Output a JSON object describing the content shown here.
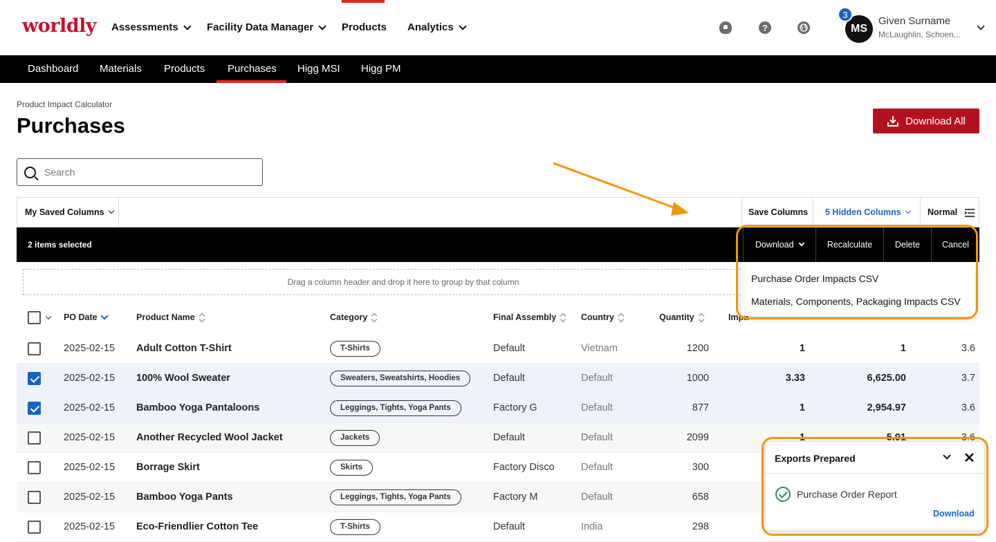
{
  "brand": {
    "logo": "worldly"
  },
  "topnav": {
    "items": [
      {
        "label": "Assessments",
        "dropdown": true
      },
      {
        "label": "Facility Data Manager",
        "dropdown": true
      },
      {
        "label": "Products",
        "dropdown": false,
        "active": true
      },
      {
        "label": "Analytics",
        "dropdown": true
      }
    ],
    "icons": [
      "notifications-icon",
      "help-icon",
      "globe-icon"
    ],
    "user": {
      "initials": "MS",
      "badge": "3",
      "name": "Given Surname",
      "org": "McLaughlin, Schoen..."
    }
  },
  "subnav": {
    "items": [
      "Dashboard",
      "Materials",
      "Products",
      "Purchases",
      "Higg MSI",
      "Higg PM"
    ],
    "active": "Purchases"
  },
  "header": {
    "breadcrumb": "Product Impact Calculator",
    "title": "Purchases",
    "download_all": "Download All"
  },
  "search": {
    "placeholder": "Search",
    "value": ""
  },
  "toolbar": {
    "saved_columns": "My Saved Columns",
    "save_columns": "Save Columns",
    "hidden_columns": "5 Hidden Columns",
    "density": "Normal"
  },
  "selection": {
    "count_text": "2 items selected",
    "actions": {
      "download": "Download",
      "recalculate": "Recalculate",
      "delete": "Delete",
      "cancel": "Cancel"
    },
    "download_menu": [
      "Purchase Order Impacts CSV",
      "Materials, Components, Packaging Impacts CSV"
    ]
  },
  "group_hint": "Drag a column header and drop it here to group by that column",
  "table": {
    "columns": [
      "PO Date",
      "Product Name",
      "Category",
      "Final Assembly",
      "Country",
      "Quantity",
      "Impa"
    ],
    "rows": [
      {
        "checked": false,
        "date": "2025-02-15",
        "name": "Adult Cotton T-Shirt",
        "category": "T-Shirts",
        "assembly": "Default",
        "country": "Vietnam",
        "qty": "1200",
        "c1": "1",
        "c2": "1",
        "c3": "3.6"
      },
      {
        "checked": true,
        "date": "2025-02-15",
        "name": "100% Wool Sweater",
        "category": "Sweaters, Sweatshirts, Hoodies",
        "assembly": "Default",
        "country": "Default",
        "qty": "1000",
        "c1": "3.33",
        "c2": "6,625.00",
        "c3": "3.7"
      },
      {
        "checked": true,
        "date": "2025-02-15",
        "name": "Bamboo Yoga Pantaloons",
        "category": "Leggings, Tights, Yoga Pants",
        "assembly": "Factory G",
        "country": "Default",
        "qty": "877",
        "c1": "1",
        "c2": "2,954.97",
        "c3": "3.6"
      },
      {
        "checked": false,
        "date": "2025-02-15",
        "name": "Another Recycled Wool Jacket",
        "category": "Jackets",
        "assembly": "Default",
        "country": "Default",
        "qty": "2099",
        "c1": "1",
        "c2": "5.91",
        "c3": "3.6"
      },
      {
        "checked": false,
        "date": "2025-02-15",
        "name": "Borrage Skirt",
        "category": "Skirts",
        "assembly": "Factory Disco",
        "country": "Default",
        "qty": "300",
        "c1": "",
        "c2": "",
        "c3": ""
      },
      {
        "checked": false,
        "date": "2025-02-15",
        "name": "Bamboo Yoga Pants",
        "category": "Leggings, Tights, Yoga Pants",
        "assembly": "Factory M",
        "country": "Default",
        "qty": "658",
        "c1": "",
        "c2": "",
        "c3": ""
      },
      {
        "checked": false,
        "date": "2025-02-15",
        "name": "Eco-Friendlier Cotton Tee",
        "category": "T-Shirts",
        "assembly": "Default",
        "country": "India",
        "qty": "298",
        "c1": "",
        "c2": "",
        "c3": ""
      }
    ]
  },
  "export_panel": {
    "title": "Exports Prepared",
    "item": "Purchase Order Report",
    "link": "Download"
  },
  "colors": {
    "brand_red": "#c8102e",
    "button_red": "#b5101d",
    "link_blue": "#1565c0",
    "annotation_orange": "#f2960c"
  }
}
